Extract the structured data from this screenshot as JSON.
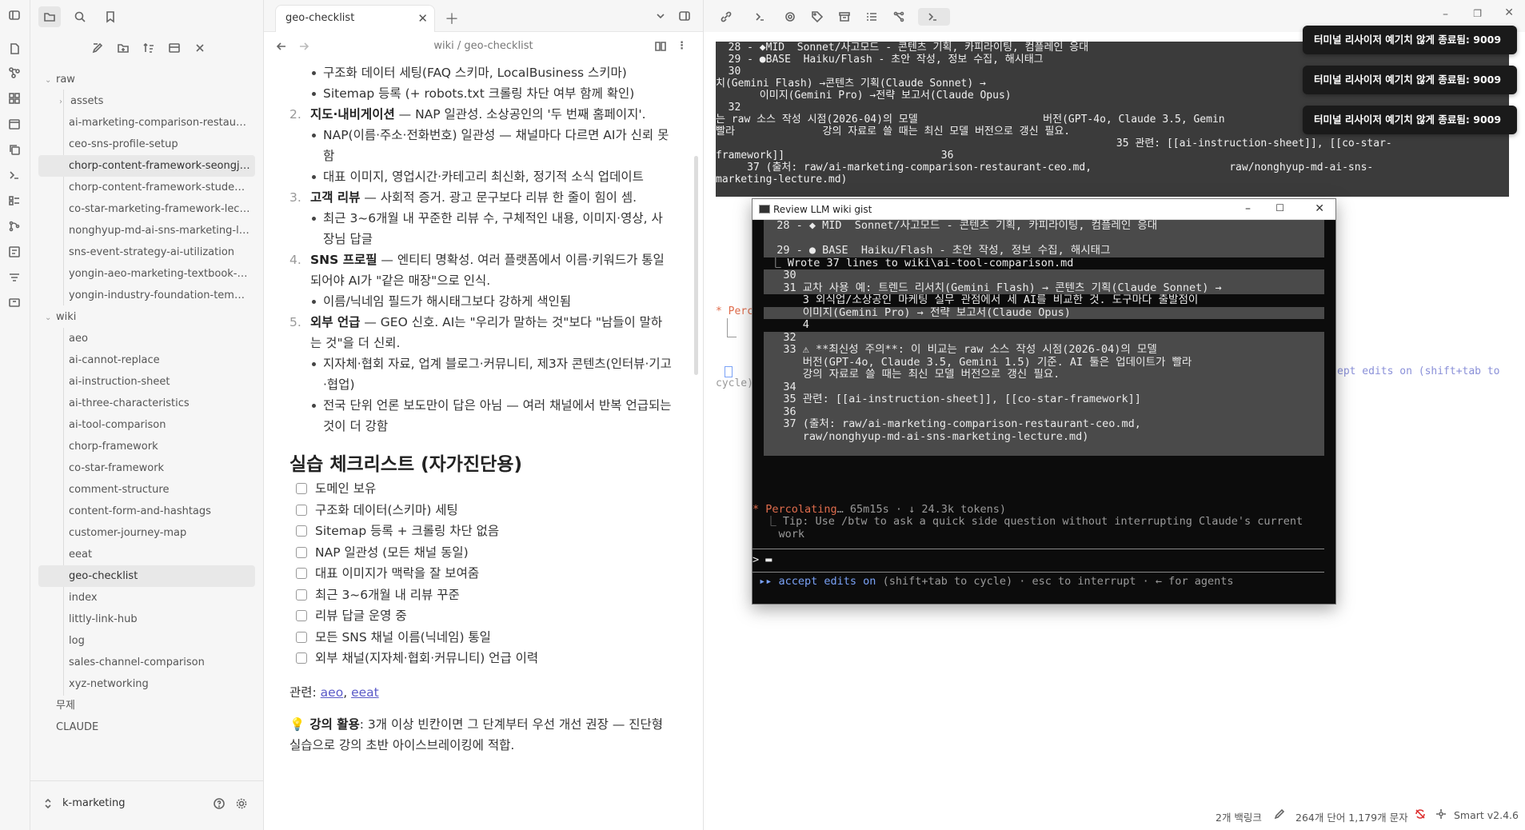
{
  "ribbon": {
    "icons": [
      "sidebar-toggle-icon",
      "file-icon",
      "graph-icon",
      "canvas-icon",
      "calendar-icon",
      "copy-icon",
      "terminal-icon",
      "list-icon",
      "git-icon",
      "template-icon",
      "filter-icon",
      "slides-icon"
    ]
  },
  "sidebar": {
    "top_icons": [
      "folder-icon",
      "search-icon",
      "bookmark-icon"
    ],
    "nav_icons": [
      "new-note-icon",
      "new-folder-icon",
      "sort-icon",
      "collapse-icon",
      "close-icon"
    ],
    "tree": [
      {
        "label": "raw",
        "type": "folder",
        "level": 0
      },
      {
        "label": "assets",
        "type": "folder-collapsed",
        "level": 1
      },
      {
        "label": "ai-marketing-comparison-restaura...",
        "type": "file",
        "level": 1
      },
      {
        "label": "ceo-sns-profile-setup",
        "type": "file",
        "level": 1
      },
      {
        "label": "chorp-content-framework-seongju...",
        "type": "file",
        "level": 1,
        "selected": true
      },
      {
        "label": "chorp-content-framework-student-...",
        "type": "file",
        "level": 1
      },
      {
        "label": "co-star-marketing-framework-lecture",
        "type": "file",
        "level": 1
      },
      {
        "label": "nonghyup-md-ai-sns-marketing-le...",
        "type": "file",
        "level": 1
      },
      {
        "label": "sns-event-strategy-ai-utilization",
        "type": "file",
        "level": 1
      },
      {
        "label": "yongin-aeo-marketing-textbook-full",
        "type": "file",
        "level": 1
      },
      {
        "label": "yongin-industry-foundation-templ...",
        "type": "file",
        "level": 1
      },
      {
        "label": "wiki",
        "type": "folder",
        "level": 0
      },
      {
        "label": "aeo",
        "type": "file",
        "level": 1
      },
      {
        "label": "ai-cannot-replace",
        "type": "file",
        "level": 1
      },
      {
        "label": "ai-instruction-sheet",
        "type": "file",
        "level": 1
      },
      {
        "label": "ai-three-characteristics",
        "type": "file",
        "level": 1
      },
      {
        "label": "ai-tool-comparison",
        "type": "file",
        "level": 1
      },
      {
        "label": "chorp-framework",
        "type": "file",
        "level": 1
      },
      {
        "label": "co-star-framework",
        "type": "file",
        "level": 1
      },
      {
        "label": "comment-structure",
        "type": "file",
        "level": 1
      },
      {
        "label": "content-form-and-hashtags",
        "type": "file",
        "level": 1
      },
      {
        "label": "customer-journey-map",
        "type": "file",
        "level": 1
      },
      {
        "label": "eeat",
        "type": "file",
        "level": 1
      },
      {
        "label": "geo-checklist",
        "type": "file",
        "level": 1,
        "selected": true
      },
      {
        "label": "index",
        "type": "file",
        "level": 1
      },
      {
        "label": "littly-link-hub",
        "type": "file",
        "level": 1
      },
      {
        "label": "log",
        "type": "file",
        "level": 1
      },
      {
        "label": "sales-channel-comparison",
        "type": "file",
        "level": 1
      },
      {
        "label": "xyz-networking",
        "type": "file",
        "level": 1
      },
      {
        "label": "무제",
        "type": "file",
        "level": 0
      },
      {
        "label": "CLAUDE",
        "type": "file",
        "level": 0
      }
    ],
    "vault_name": "k-marketing"
  },
  "editor": {
    "tab_title": "geo-checklist",
    "breadcrumb": "wiki / geo-checklist",
    "lines": [
      {
        "kind": "ul",
        "text": "구조화 데이터 세팅(FAQ 스키마, LocalBusiness 스키마)"
      },
      {
        "kind": "ul",
        "text": "Sitemap 등록 (+ robots.txt 크롤링 차단 여부 함께 확인)"
      },
      {
        "kind": "ol",
        "num": "2.",
        "bold": "지도·내비게이션",
        "text": " — NAP 일관성. 소상공인의 '두 번째 홈페이지'."
      },
      {
        "kind": "ul",
        "text": "NAP(이름·주소·전화번호) 일관성 — 채널마다 다르면 AI가 신뢰 못함"
      },
      {
        "kind": "ul",
        "text": "대표 이미지, 영업시간·카테고리 최신화, 정기적 소식 업데이트"
      },
      {
        "kind": "ol",
        "num": "3.",
        "bold": "고객 리뷰",
        "text": " — 사회적 증거. 광고 문구보다 리뷰 한 줄이 힘이 셈."
      },
      {
        "kind": "ul",
        "text": "최근 3~6개월 내 꾸준한 리뷰 수, 구체적인 내용, 이미지·영상, 사장님 답글"
      },
      {
        "kind": "ol",
        "num": "4.",
        "bold": "SNS 프로필",
        "text": " — 엔티티 명확성. 여러 플랫폼에서 이름·키워드가 통일되어야 AI가 \"같은 매장\"으로 인식."
      },
      {
        "kind": "ul",
        "text": "이름/닉네임 필드가 해시태그보다 강하게 색인됨"
      },
      {
        "kind": "ol",
        "num": "5.",
        "bold": "외부 언급",
        "text": " — GEO 신호. AI는 \"우리가 말하는 것\"보다 \"남들이 말하는 것\"을 더 신뢰."
      },
      {
        "kind": "ul",
        "text": "지자체·협회 자료, 업계 블로그·커뮤니티, 제3자 콘텐츠(인터뷰·기고·협업)"
      },
      {
        "kind": "ul",
        "text": "전국 단위 언론 보도만이 답은 아님 — 여러 채널에서 반복 언급되는 것이 더 강함"
      }
    ],
    "checklist_title": "실습 체크리스트 (자가진단용)",
    "checklist": [
      "도메인 보유",
      "구조화 데이터(스키마) 세팅",
      "Sitemap 등록 + 크롤링 차단 없음",
      "NAP 일관성 (모든 채널 동일)",
      "대표 이미지가 맥락을 잘 보여줌",
      "최근 3~6개월 내 리뷰 꾸준",
      "리뷰 답글 운영 중",
      "모든 SNS 채널 이름(닉네임) 통일",
      "외부 채널(지자체·협회·커뮤니티) 언급 이력"
    ],
    "related_label": "관련: ",
    "related_links": [
      "aeo",
      "eeat"
    ],
    "tip_icon": "💡",
    "tip_bold": "강의 활용",
    "tip_text": ": 3개 이상 빈칸이면 그 단계부터 우선 개선 권장 — 진단형 실습으로 강의 초반 아이스브레이킹에 적합."
  },
  "terminal_bg": {
    "lines": [
      "  28 - ◆MID  Sonnet/사고모드 - 콘텐츠 기획, 카피라이팅, 컴플레인 응대",
      "  29 - ●BASE  Haiku/Flash - 초안 작성, 정보 수집, 해시태그",
      "  30",
      "치(Gemini Flash) →콘텐츠 기획(Claude Sonnet) →",
      "       이미지(Gemini Pro) →전략 보고서(Claude Opus)",
      "  32",
      "는 raw 소스 작성 시점(2026-04)의 모델                    버전(GPT-4o, Claude 3.5, Gemin",
      "빨라              강의 자료로 쓸 때는 최신 모델 버전으로 갱신 필요.",
      "                                                                35 관련: [[ai-instruction-sheet]], [[co-star-",
      "framework]]                         36",
      "     37 (출처: raw/ai-marketing-comparison-restaurant-ceo.md,                      raw/nonghyup-md-ai-sns-",
      "marketing-lecture.md)"
    ],
    "fragment_left": "* Perc",
    "fragment_right": "ept edits on (shift+tab to",
    "fragment_cycle": "cycle)"
  },
  "toasts": [
    "터미널 리사이저 예기치 않게 종료됨: 9009",
    "터미널 리사이저 예기치 않게 종료됨: 9009",
    "터미널 리사이저 예기치 않게 종료됨: 9009"
  ],
  "popup": {
    "title": "Review LLM wiki gist",
    "lines": [
      {
        "t": "  28 - ◆ MID  Sonnet/사고모드 - 콘텐츠 기획, 카피라이팅, 컴플레인 응대",
        "hl": true
      },
      {
        "t": "",
        "hl": true
      },
      {
        "t": "  29 - ● BASE  Haiku/Flash - 초안 작성, 정보 수집, 해시태그",
        "hl": true
      },
      {
        "t": " ⎿ Wrote 37 lines to wiki\\ai-tool-comparison.md",
        "hl": false
      },
      {
        "t": "   30",
        "hl": true
      },
      {
        "t": "   31 교차 사용 예: 트렌드 리서치(Gemini Flash) → 콘텐츠 기획(Claude Sonnet) →",
        "hl": true
      },
      {
        "t": "      3 외식업/소상공인 마케팅 실무 관점에서 세 AI를 비교한 것. 도구마다 출발점이",
        "hl": false
      },
      {
        "t": "      이미지(Gemini Pro) → 전략 보고서(Claude Opus)",
        "hl": true
      },
      {
        "t": "      4",
        "hl": false
      },
      {
        "t": "   32",
        "hl": true
      },
      {
        "t": "   33 ⚠ **최신성 주의**: 이 비교는 raw 소스 작성 시점(2026-04)의 모델",
        "hl": true
      },
      {
        "t": "      버전(GPT-4o, Claude 3.5, Gemini 1.5) 기준. AI 툴은 업데이트가 빨라",
        "hl": true
      },
      {
        "t": "      강의 자료로 쓸 때는 최신 모델 버전으로 갱신 필요.",
        "hl": true
      },
      {
        "t": "   34",
        "hl": true
      },
      {
        "t": "   35 관련: [[ai-instruction-sheet]], [[co-star-framework]]",
        "hl": true
      },
      {
        "t": "   36",
        "hl": true
      },
      {
        "t": "   37 (출처: raw/ai-marketing-comparison-restaurant-ceo.md,",
        "hl": true
      },
      {
        "t": "      raw/nonghyup-md-ai-sns-marketing-lecture.md)",
        "hl": true
      },
      {
        "t": "",
        "hl": true
      }
    ],
    "percolating": "* Percolating",
    "percolating_meta": "… 65m15s · ↓ 24.3k tokens)",
    "tip": "  ⎿ Tip: Use /btw to ask a quick side question without interrupting Claude's current",
    "tip2": "    work",
    "prompt": "> ▬",
    "footer_accent": " ▸▸ accept edits on",
    "footer_rest": " (shift+tab to cycle) · esc to interrupt · ← for agents"
  },
  "statusbar": {
    "backlinks": "2개 백링크",
    "counts": "264개 단어  1,179개 문자",
    "plugin": "Smart v2.4.6"
  }
}
